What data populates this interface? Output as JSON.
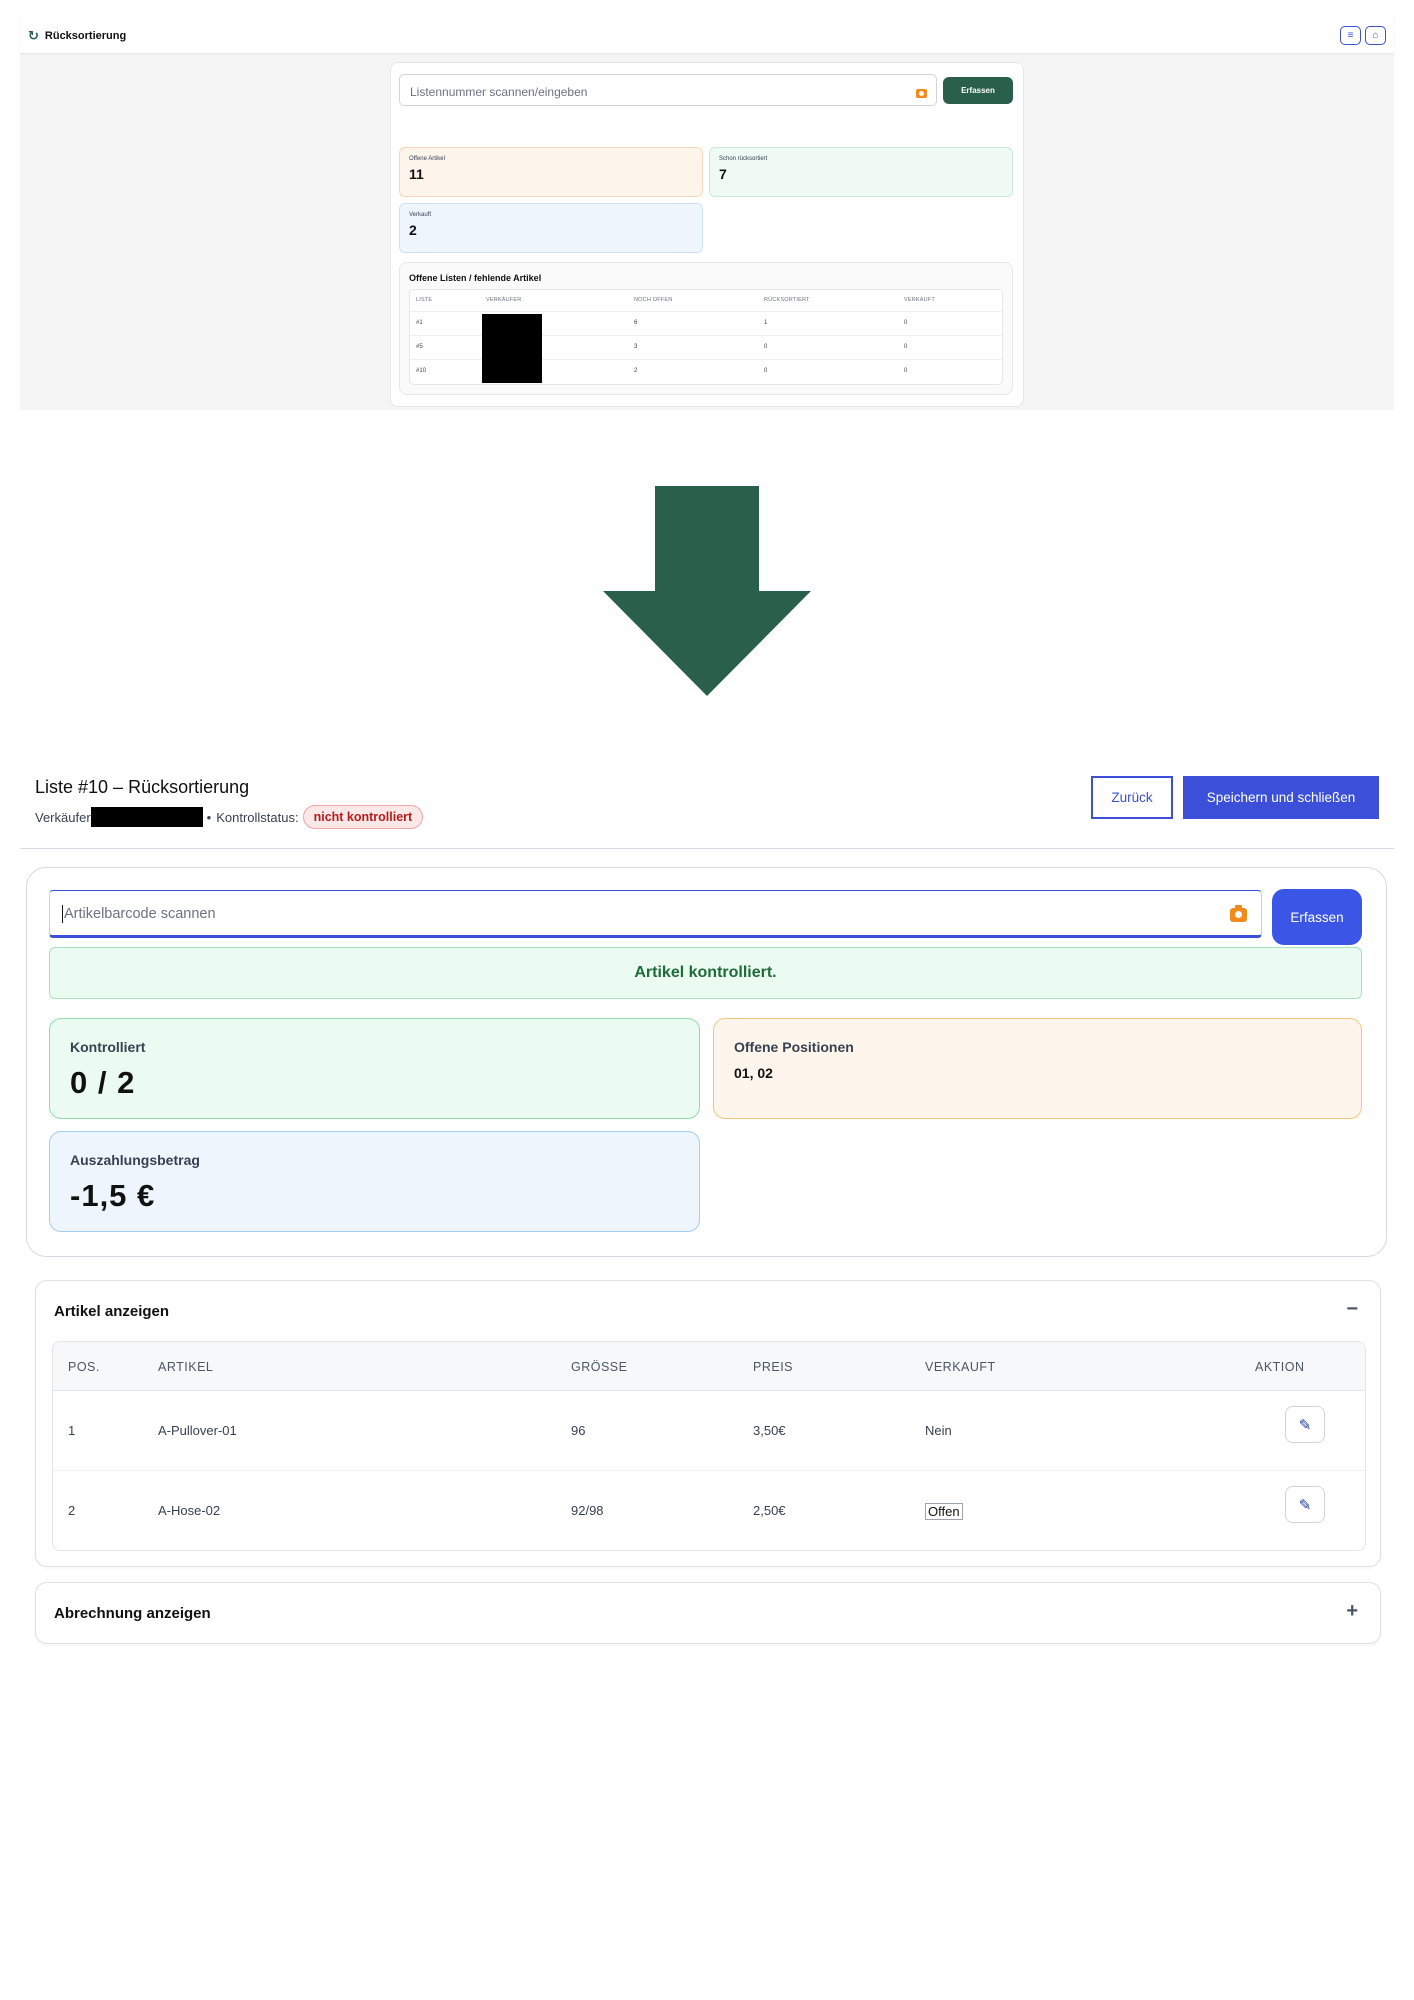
{
  "top_screenshot": {
    "app_title": "Rücksortierung",
    "scan_placeholder": "Listennummer scannen/eingeben",
    "capture_label": "Erfassen",
    "stats": {
      "offene_artikel": {
        "label": "Offene Artikel",
        "value": "11"
      },
      "schon_ruecksortiert": {
        "label": "Schon rücksortiert",
        "value": "7"
      },
      "verkauft": {
        "label": "Verkauft",
        "value": "2"
      }
    },
    "table": {
      "title": "Offene Listen / fehlende Artikel",
      "headers": [
        "LISTE",
        "VERKÄUFER",
        "NOCH OFFEN",
        "RÜCKSORTIERT",
        "VERKAUFT"
      ],
      "rows": [
        {
          "liste": "#1",
          "noch_offen": "6",
          "ruecksortiert": "1",
          "verkauft": "0"
        },
        {
          "liste": "#5",
          "noch_offen": "3",
          "ruecksortiert": "0",
          "verkauft": "0"
        },
        {
          "liste": "#10",
          "noch_offen": "2",
          "ruecksortiert": "0",
          "verkauft": "0"
        }
      ]
    }
  },
  "bottom_screenshot": {
    "title": "Liste #10 – Rücksortierung",
    "seller_label": "Verkäufer",
    "separator": "•",
    "control_status_label": "Kontrollstatus:",
    "control_status_value": "nicht kontrolliert",
    "back_label": "Zurück",
    "save_close_label": "Speichern und schließen",
    "scan_placeholder": "Artikelbarcode scannen",
    "capture_label": "Erfassen",
    "success_message": "Artikel kontrolliert.",
    "stats": {
      "kontrolliert": {
        "label": "Kontrolliert",
        "value": "0 / 2"
      },
      "offene_positionen": {
        "label": "Offene Positionen",
        "value": "01, 02"
      },
      "auszahlungsbetrag": {
        "label": "Auszahlungsbetrag",
        "value": "-1,5 €"
      }
    },
    "articles_section": {
      "title": "Artikel anzeigen",
      "toggle": "−",
      "headers": [
        "POS.",
        "ARTIKEL",
        "GRÖSSE",
        "PREIS",
        "VERKAUFT",
        "AKTION"
      ],
      "rows": [
        {
          "pos": "1",
          "artikel": "A-Pullover-01",
          "groesse": "96",
          "preis": "3,50€",
          "verkauft": "Nein"
        },
        {
          "pos": "2",
          "artikel": "A-Hose-02",
          "groesse": "92/98",
          "preis": "2,50€",
          "verkauft": "Offen"
        }
      ]
    },
    "billing_section": {
      "title": "Abrechnung anzeigen",
      "toggle": "+"
    }
  },
  "colors": {
    "brand_green": "#2a5f4c",
    "accent_blue": "#3b4fd9",
    "arrow": "#2a5f4c",
    "camera_orange": "#f28a1c"
  },
  "icons": {
    "brand": "refresh-icon",
    "menu": "menu-icon",
    "home": "home-icon",
    "camera": "camera-icon",
    "edit": "pencil-icon"
  }
}
